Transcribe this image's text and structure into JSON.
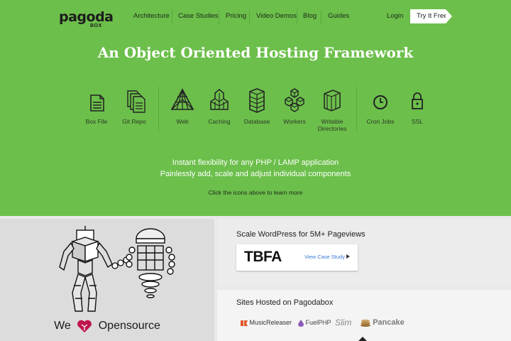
{
  "brand": {
    "logo_text": "pagoda",
    "logo_sub": "BOX"
  },
  "nav": {
    "items": [
      "Architecture",
      "Case Studies",
      "Pricing",
      "Video Demos",
      "Blog",
      "Guides"
    ],
    "login": "Login",
    "cta": "Try It Free"
  },
  "hero": {
    "headline": "An Object Oriented Hosting Framework",
    "features": [
      {
        "label": "Box File",
        "icon": "box-file-icon"
      },
      {
        "label": "Git Repo",
        "icon": "git-repo-icon"
      },
      {
        "label": "Web",
        "icon": "web-icon"
      },
      {
        "label": "Caching",
        "icon": "caching-icon"
      },
      {
        "label": "Database",
        "icon": "database-icon"
      },
      {
        "label": "Workers",
        "icon": "workers-icon"
      },
      {
        "label": "Writable Directories",
        "icon": "writable-directories-icon"
      },
      {
        "label": "Cron Jobs",
        "icon": "clock-icon"
      },
      {
        "label": "SSL",
        "icon": "lock-icon"
      }
    ],
    "tagline_1": "Instant flexibility for any PHP / LAMP application",
    "tagline_2": "Painlessly add, scale and adjust individual components",
    "hint": "Click the icons above to learn more"
  },
  "opensource": {
    "we": "We",
    "opensource": "Opensource"
  },
  "case_study": {
    "title": "Scale WordPress for 5M+ Pageviews",
    "client": "TBFA",
    "link": "View Case Study"
  },
  "sites": {
    "title": "Sites Hosted on Pagodabox",
    "clients": [
      "MusicReleaser",
      "FuelPHP",
      "Slim",
      "Pancake"
    ]
  },
  "colors": {
    "hero_green": "#6cbf4b",
    "cta_white": "#ffffff",
    "heart": "#c0144c"
  }
}
